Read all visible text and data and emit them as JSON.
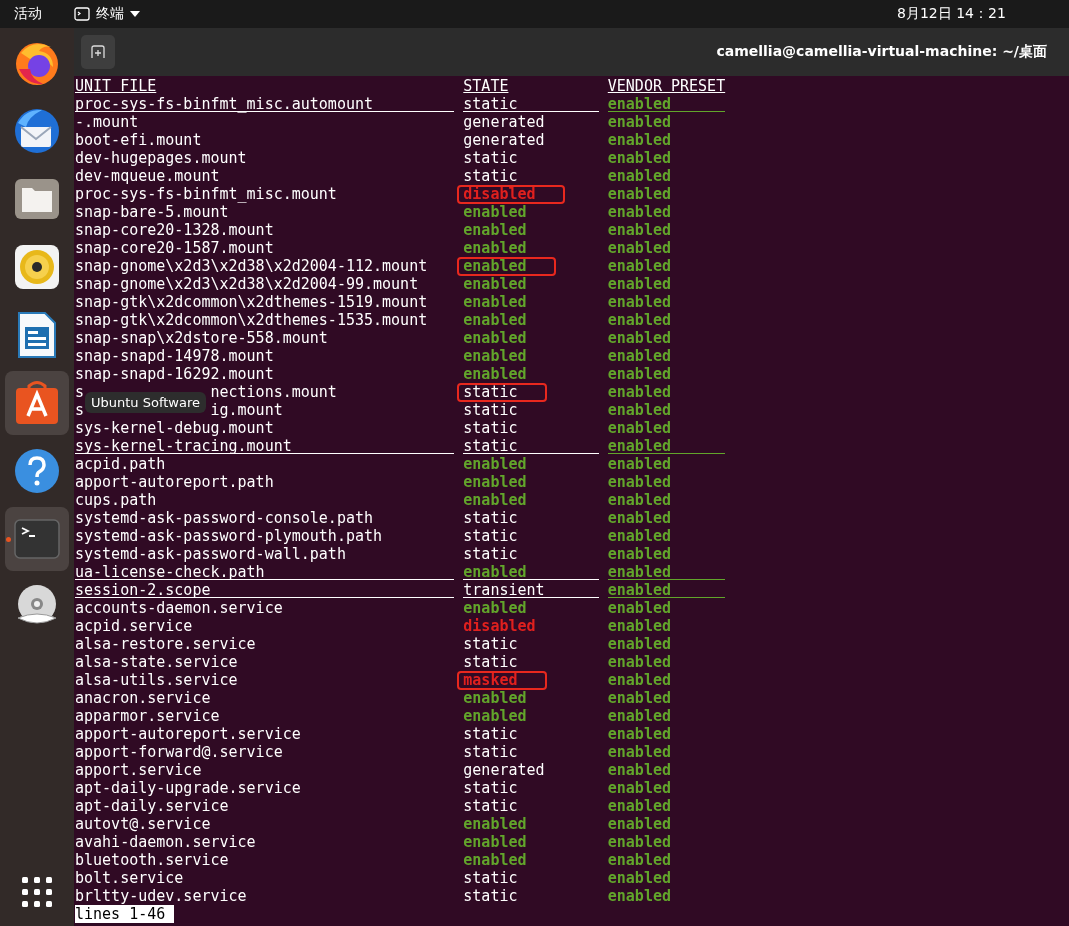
{
  "top_bar": {
    "activities": "活动",
    "app_menu": "终端",
    "clock": "8月12日  14：21"
  },
  "dock": {
    "items": [
      {
        "kind": "browser",
        "selected": false,
        "running": false
      },
      {
        "kind": "mail",
        "selected": false,
        "running": false
      },
      {
        "kind": "files",
        "selected": false,
        "running": false
      },
      {
        "kind": "music",
        "selected": false,
        "running": false
      },
      {
        "kind": "writer",
        "selected": false,
        "running": false
      },
      {
        "kind": "software",
        "selected": true,
        "running": false,
        "tooltip": "Ubuntu Software"
      },
      {
        "kind": "help",
        "selected": false,
        "running": false
      },
      {
        "kind": "terminal",
        "selected": true,
        "running": true
      },
      {
        "kind": "dvd",
        "selected": false,
        "running": false
      }
    ]
  },
  "terminal": {
    "title": "camellia@camellia-virtual-machine: ~/桌面",
    "columns": [
      "UNIT FILE",
      "STATE",
      "VENDOR PRESET"
    ],
    "rows": [
      {
        "unit": "proc-sys-fs-binfmt_misc.automount",
        "state": {
          "text": "static",
          "color": "#ffffff",
          "bold": false
        },
        "vendor": "enabled",
        "underlined": true,
        "boxed": false
      },
      {
        "unit": "-.mount",
        "state": {
          "text": "generated",
          "color": "#ffffff",
          "bold": false
        },
        "vendor": "enabled",
        "underlined": false,
        "boxed": false
      },
      {
        "unit": "boot-efi.mount",
        "state": {
          "text": "generated",
          "color": "#ffffff",
          "bold": false
        },
        "vendor": "enabled",
        "underlined": false,
        "boxed": false
      },
      {
        "unit": "dev-hugepages.mount",
        "state": {
          "text": "static",
          "color": "#ffffff",
          "bold": false
        },
        "vendor": "enabled",
        "underlined": false,
        "boxed": false
      },
      {
        "unit": "dev-mqueue.mount",
        "state": {
          "text": "static",
          "color": "#ffffff",
          "bold": false
        },
        "vendor": "enabled",
        "underlined": false,
        "boxed": false
      },
      {
        "unit": "proc-sys-fs-binfmt_misc.mount",
        "state": {
          "text": "disabled",
          "color": "#e0201e",
          "bold": true
        },
        "vendor": "enabled",
        "underlined": false,
        "boxed": true
      },
      {
        "unit": "snap-bare-5.mount",
        "state": {
          "text": "enabled",
          "color": "#62a52b",
          "bold": true
        },
        "vendor": "enabled",
        "underlined": false,
        "boxed": false
      },
      {
        "unit": "snap-core20-1328.mount",
        "state": {
          "text": "enabled",
          "color": "#62a52b",
          "bold": true
        },
        "vendor": "enabled",
        "underlined": false,
        "boxed": false
      },
      {
        "unit": "snap-core20-1587.mount",
        "state": {
          "text": "enabled",
          "color": "#62a52b",
          "bold": true
        },
        "vendor": "enabled",
        "underlined": false,
        "boxed": false
      },
      {
        "unit": "snap-gnome\\x2d3\\x2d38\\x2d2004-112.mount",
        "state": {
          "text": "enabled",
          "color": "#62a52b",
          "bold": true
        },
        "vendor": "enabled",
        "underlined": false,
        "boxed": true
      },
      {
        "unit": "snap-gnome\\x2d3\\x2d38\\x2d2004-99.mount",
        "state": {
          "text": "enabled",
          "color": "#62a52b",
          "bold": true
        },
        "vendor": "enabled",
        "underlined": false,
        "boxed": false
      },
      {
        "unit": "snap-gtk\\x2dcommon\\x2dthemes-1519.mount",
        "state": {
          "text": "enabled",
          "color": "#62a52b",
          "bold": true
        },
        "vendor": "enabled",
        "underlined": false,
        "boxed": false
      },
      {
        "unit": "snap-gtk\\x2dcommon\\x2dthemes-1535.mount",
        "state": {
          "text": "enabled",
          "color": "#62a52b",
          "bold": true
        },
        "vendor": "enabled",
        "underlined": false,
        "boxed": false
      },
      {
        "unit": "snap-snap\\x2dstore-558.mount",
        "state": {
          "text": "enabled",
          "color": "#62a52b",
          "bold": true
        },
        "vendor": "enabled",
        "underlined": false,
        "boxed": false
      },
      {
        "unit": "snap-snapd-14978.mount",
        "state": {
          "text": "enabled",
          "color": "#62a52b",
          "bold": true
        },
        "vendor": "enabled",
        "underlined": false,
        "boxed": false
      },
      {
        "unit": "snap-snapd-16292.mount",
        "state": {
          "text": "enabled",
          "color": "#62a52b",
          "bold": true
        },
        "vendor": "enabled",
        "underlined": false,
        "boxed": false
      },
      {
        "unit": "s",
        "unit_rest": "nections.mount",
        "state": {
          "text": "static",
          "color": "#ffffff",
          "bold": false
        },
        "vendor": "enabled",
        "underlined": false,
        "boxed": true
      },
      {
        "unit": "s",
        "unit_rest": "ig.mount",
        "state": {
          "text": "static",
          "color": "#ffffff",
          "bold": false
        },
        "vendor": "enabled",
        "underlined": false,
        "boxed": false
      },
      {
        "unit": "sys-kernel-debug.mount",
        "state": {
          "text": "static",
          "color": "#ffffff",
          "bold": false
        },
        "vendor": "enabled",
        "underlined": false,
        "boxed": false
      },
      {
        "unit": "sys-kernel-tracing.mount",
        "state": {
          "text": "static",
          "color": "#ffffff",
          "bold": false
        },
        "vendor": "enabled",
        "underlined": true,
        "boxed": false
      },
      {
        "unit": "acpid.path",
        "state": {
          "text": "enabled",
          "color": "#62a52b",
          "bold": true
        },
        "vendor": "enabled",
        "underlined": false,
        "boxed": false
      },
      {
        "unit": "apport-autoreport.path",
        "state": {
          "text": "enabled",
          "color": "#62a52b",
          "bold": true
        },
        "vendor": "enabled",
        "underlined": false,
        "boxed": false
      },
      {
        "unit": "cups.path",
        "state": {
          "text": "enabled",
          "color": "#62a52b",
          "bold": true
        },
        "vendor": "enabled",
        "underlined": false,
        "boxed": false
      },
      {
        "unit": "systemd-ask-password-console.path",
        "state": {
          "text": "static",
          "color": "#ffffff",
          "bold": false
        },
        "vendor": "enabled",
        "underlined": false,
        "boxed": false
      },
      {
        "unit": "systemd-ask-password-plymouth.path",
        "state": {
          "text": "static",
          "color": "#ffffff",
          "bold": false
        },
        "vendor": "enabled",
        "underlined": false,
        "boxed": false
      },
      {
        "unit": "systemd-ask-password-wall.path",
        "state": {
          "text": "static",
          "color": "#ffffff",
          "bold": false
        },
        "vendor": "enabled",
        "underlined": false,
        "boxed": false
      },
      {
        "unit": "ua-license-check.path",
        "state": {
          "text": "enabled",
          "color": "#62a52b",
          "bold": true
        },
        "vendor": "enabled",
        "underlined": true,
        "boxed": false
      },
      {
        "unit": "session-2.scope",
        "state": {
          "text": "transient",
          "color": "#ffffff",
          "bold": false
        },
        "vendor": "enabled",
        "underlined": true,
        "boxed": false
      },
      {
        "unit": "accounts-daemon.service",
        "state": {
          "text": "enabled",
          "color": "#62a52b",
          "bold": true
        },
        "vendor": "enabled",
        "underlined": false,
        "boxed": false
      },
      {
        "unit": "acpid.service",
        "state": {
          "text": "disabled",
          "color": "#e0201e",
          "bold": true
        },
        "vendor": "enabled",
        "underlined": false,
        "boxed": false
      },
      {
        "unit": "alsa-restore.service",
        "state": {
          "text": "static",
          "color": "#ffffff",
          "bold": false
        },
        "vendor": "enabled",
        "underlined": false,
        "boxed": false
      },
      {
        "unit": "alsa-state.service",
        "state": {
          "text": "static",
          "color": "#ffffff",
          "bold": false
        },
        "vendor": "enabled",
        "underlined": false,
        "boxed": false
      },
      {
        "unit": "alsa-utils.service",
        "state": {
          "text": "masked",
          "color": "#e0201e",
          "bold": true
        },
        "vendor": "enabled",
        "underlined": false,
        "boxed": true
      },
      {
        "unit": "anacron.service",
        "state": {
          "text": "enabled",
          "color": "#62a52b",
          "bold": true
        },
        "vendor": "enabled",
        "underlined": false,
        "boxed": false
      },
      {
        "unit": "apparmor.service",
        "state": {
          "text": "enabled",
          "color": "#62a52b",
          "bold": true
        },
        "vendor": "enabled",
        "underlined": false,
        "boxed": false
      },
      {
        "unit": "apport-autoreport.service",
        "state": {
          "text": "static",
          "color": "#ffffff",
          "bold": false
        },
        "vendor": "enabled",
        "underlined": false,
        "boxed": false
      },
      {
        "unit": "apport-forward@.service",
        "state": {
          "text": "static",
          "color": "#ffffff",
          "bold": false
        },
        "vendor": "enabled",
        "underlined": false,
        "boxed": false
      },
      {
        "unit": "apport.service",
        "state": {
          "text": "generated",
          "color": "#ffffff",
          "bold": false
        },
        "vendor": "enabled",
        "underlined": false,
        "boxed": false
      },
      {
        "unit": "apt-daily-upgrade.service",
        "state": {
          "text": "static",
          "color": "#ffffff",
          "bold": false
        },
        "vendor": "enabled",
        "underlined": false,
        "boxed": false
      },
      {
        "unit": "apt-daily.service",
        "state": {
          "text": "static",
          "color": "#ffffff",
          "bold": false
        },
        "vendor": "enabled",
        "underlined": false,
        "boxed": false
      },
      {
        "unit": "autovt@.service",
        "state": {
          "text": "enabled",
          "color": "#62a52b",
          "bold": true
        },
        "vendor": "enabled",
        "underlined": false,
        "boxed": false
      },
      {
        "unit": "avahi-daemon.service",
        "state": {
          "text": "enabled",
          "color": "#62a52b",
          "bold": true
        },
        "vendor": "enabled",
        "underlined": false,
        "boxed": false
      },
      {
        "unit": "bluetooth.service",
        "state": {
          "text": "enabled",
          "color": "#62a52b",
          "bold": true
        },
        "vendor": "enabled",
        "underlined": false,
        "boxed": false
      },
      {
        "unit": "bolt.service",
        "state": {
          "text": "static",
          "color": "#ffffff",
          "bold": false
        },
        "vendor": "enabled",
        "underlined": false,
        "boxed": false
      },
      {
        "unit": "brltty-udev.service",
        "state": {
          "text": "static",
          "color": "#ffffff",
          "bold": false
        },
        "vendor": "enabled",
        "underlined": false,
        "boxed": false
      }
    ],
    "status": "lines 1-46"
  }
}
